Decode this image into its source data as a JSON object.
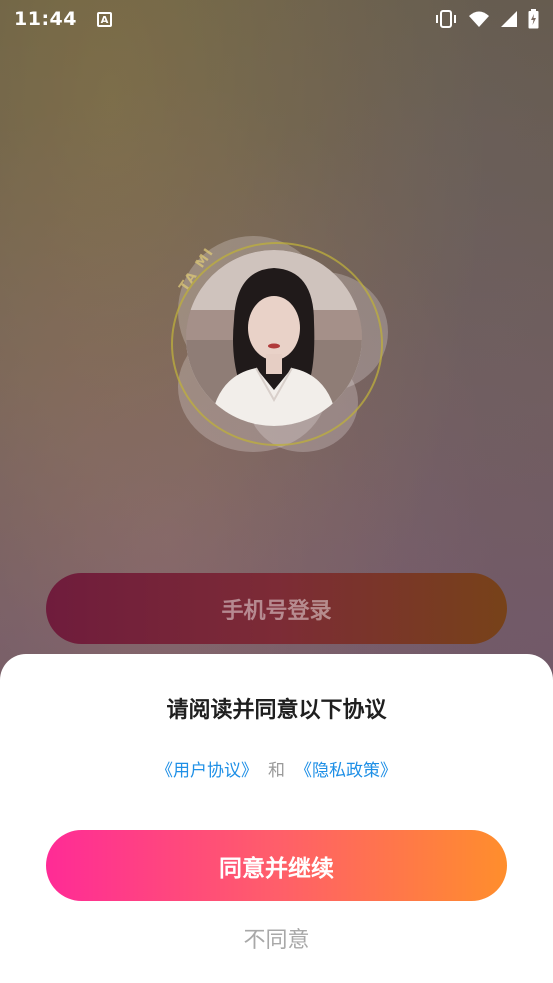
{
  "status_bar": {
    "time": "11:44",
    "notification_letter": "A"
  },
  "logo": {
    "text": "TA MI"
  },
  "login": {
    "phone_login_label": "手机号登录"
  },
  "dialog": {
    "title": "请阅读并同意以下协议",
    "user_agreement": "《用户协议》",
    "and_text": "和",
    "privacy_policy": "《隐私政策》",
    "agree_label": "同意并继续",
    "disagree_label": "不同意"
  }
}
